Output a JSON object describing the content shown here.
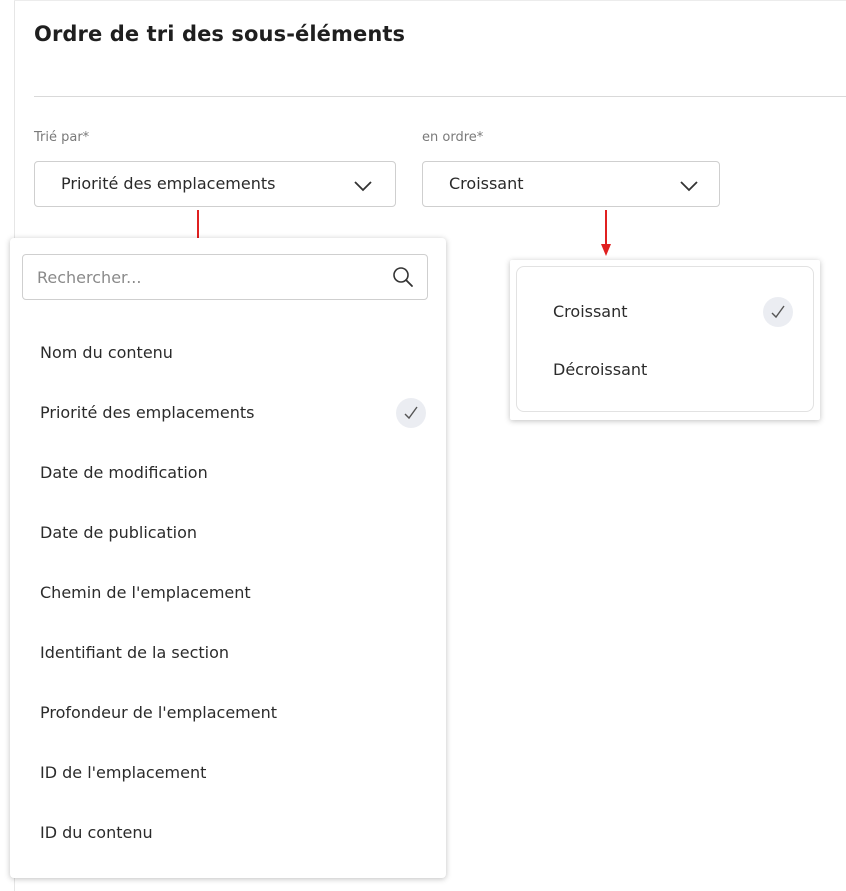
{
  "section": {
    "title": "Ordre de tri des sous-éléments"
  },
  "sort_by": {
    "label": "Trié par*",
    "value": "Priorité des emplacements",
    "search_placeholder": "Rechercher...",
    "options": [
      "Nom du contenu",
      "Priorité des emplacements",
      "Date de modification",
      "Date de publication",
      "Chemin de l'emplacement",
      "Identifiant de la section",
      "Profondeur de l'emplacement",
      "ID de l'emplacement",
      "ID du contenu"
    ],
    "selected_option": "Priorité des emplacements"
  },
  "order": {
    "label": "en ordre*",
    "value": "Croissant",
    "options": [
      "Croissant",
      "Décroissant"
    ],
    "selected_option": "Croissant"
  },
  "icons": {
    "dropdown": "chevron-down-icon",
    "search": "search-icon",
    "selected": "check-icon",
    "annotation": "red-arrow-down-icon"
  },
  "colors": {
    "annotation_arrow": "#e02020",
    "check_background": "#ebedf2",
    "border": "#cfcfcf",
    "label_text": "#7a7a7a"
  }
}
